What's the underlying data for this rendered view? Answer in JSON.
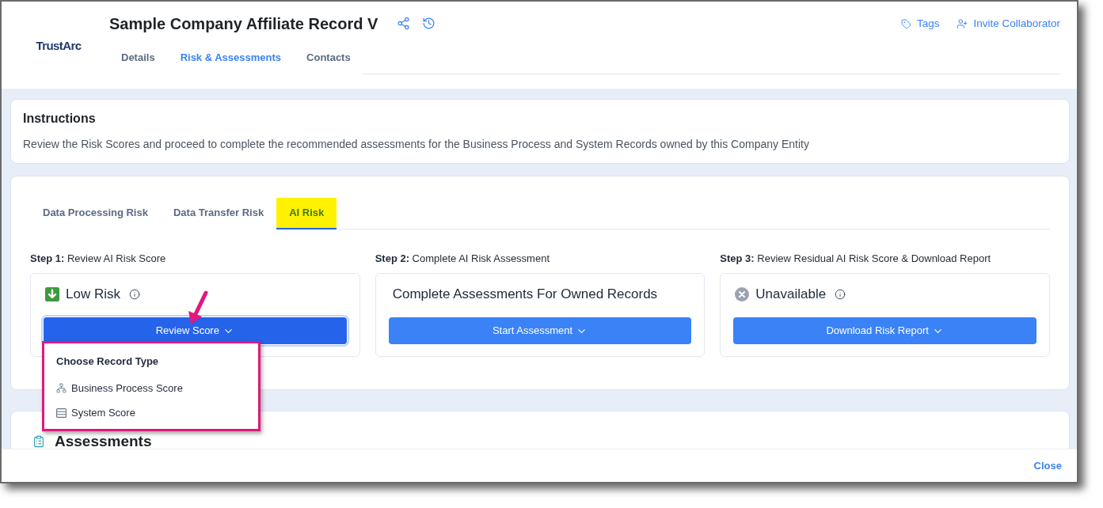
{
  "header": {
    "logo": "TrustArc",
    "title": "Sample Company Affiliate Record V",
    "actions": [
      {
        "label": "Tags"
      },
      {
        "label": "Invite Collaborator"
      }
    ]
  },
  "nav_tabs": [
    {
      "label": "Details",
      "selected": false
    },
    {
      "label": "Risk & Assessments",
      "selected": true
    },
    {
      "label": "Contacts",
      "selected": false
    }
  ],
  "instructions": {
    "title": "Instructions",
    "text": "Review the Risk Scores and proceed to complete the recommended assessments for the Business Process and System Records owned by this Company Entity"
  },
  "risk_tabs": [
    {
      "label": "Data Processing Risk",
      "selected": false,
      "highlighted": false
    },
    {
      "label": "Data Transfer Risk",
      "selected": false,
      "highlighted": false
    },
    {
      "label": "AI Risk",
      "selected": true,
      "highlighted": true
    }
  ],
  "steps": [
    {
      "label": "**Step 1:** Review AI Risk Score",
      "kind": "low",
      "title": "Low Risk",
      "info": true,
      "button": {
        "label": "Review Score",
        "focused": true
      },
      "menu": {
        "title": "Choose Record Type",
        "items": [
          {
            "label": "Business Process Score"
          },
          {
            "label": "System Score"
          }
        ]
      }
    },
    {
      "label": "**Step 2:** Complete AI Risk Assessment",
      "kind": "heading",
      "title": "Complete Assessments For Owned Records",
      "button": {
        "label": "Start Assessment",
        "focused": false
      }
    },
    {
      "label": "**Step 3:** Review Residual AI Risk Score & Download Report",
      "kind": "unavailable",
      "title": "Unavailable",
      "info": true,
      "button": {
        "label": "Download Risk Report",
        "focused": false
      }
    }
  ],
  "assessments": {
    "title": "Assessments"
  },
  "footer": {
    "close": "Close"
  }
}
